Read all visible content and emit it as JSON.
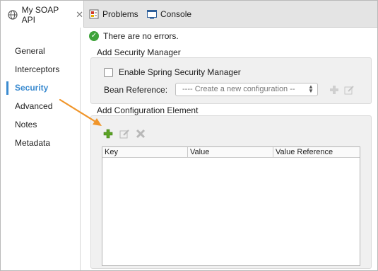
{
  "tabs": [
    {
      "label": "My SOAP API",
      "icon": "globe-icon",
      "active": true
    },
    {
      "label": "Problems",
      "icon": "problems-icon"
    },
    {
      "label": "Console",
      "icon": "console-icon"
    }
  ],
  "sidebar": {
    "items": [
      {
        "label": "General"
      },
      {
        "label": "Interceptors"
      },
      {
        "label": "Security",
        "active": true
      },
      {
        "label": "Advanced"
      },
      {
        "label": "Notes"
      },
      {
        "label": "Metadata"
      }
    ]
  },
  "status": {
    "text": "There are no errors.",
    "icon": "check-circle-icon"
  },
  "security_manager": {
    "title": "Add Security Manager",
    "checkbox_label": "Enable Spring Security Manager",
    "checked": false,
    "bean_label": "Bean Reference:",
    "bean_placeholder": "---- Create a new configuration --"
  },
  "config_element": {
    "title": "Add Configuration Element",
    "table": {
      "columns": [
        "Key",
        "Value",
        "Value Reference"
      ],
      "rows": []
    }
  },
  "colors": {
    "accent": "#3b8bd0",
    "add": "#5ba324",
    "arrow": "#f0952a",
    "ok": "#3ea33a"
  }
}
